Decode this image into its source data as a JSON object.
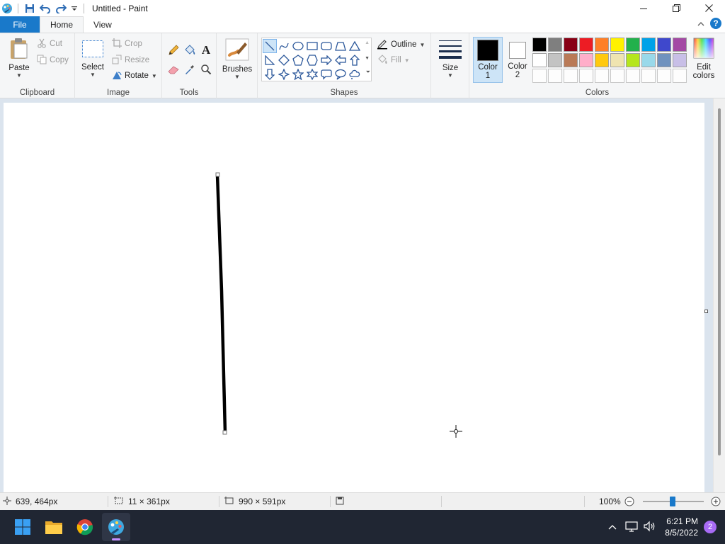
{
  "window": {
    "title": "Untitled - Paint"
  },
  "tabs": [
    {
      "label": "File"
    },
    {
      "label": "Home"
    },
    {
      "label": "View"
    }
  ],
  "clipboard": {
    "group_label": "Clipboard",
    "paste": "Paste",
    "cut": "Cut",
    "copy": "Copy"
  },
  "image": {
    "group_label": "Image",
    "select": "Select",
    "crop": "Crop",
    "resize": "Resize",
    "rotate": "Rotate"
  },
  "tools": {
    "group_label": "Tools"
  },
  "brushes": {
    "label": "Brushes"
  },
  "shapes": {
    "group_label": "Shapes",
    "outline": "Outline",
    "fill": "Fill",
    "icons": [
      "line-icon",
      "curve-icon",
      "oval-icon",
      "rectangle-icon",
      "rounded-rectangle-icon",
      "polygon-icon",
      "triangle-icon",
      "right-triangle-icon",
      "diamond-icon",
      "pentagon-icon",
      "hexagon-icon",
      "right-arrow-icon",
      "left-arrow-icon",
      "up-arrow-icon",
      "down-arrow-icon",
      "four-point-star-icon",
      "five-point-star-icon",
      "six-point-star-icon",
      "rounded-callout-icon",
      "oval-callout-icon",
      "cloud-callout-icon"
    ],
    "selected": "line-icon"
  },
  "size": {
    "label": "Size"
  },
  "colors": {
    "group_label": "Colors",
    "color1_line1": "Color",
    "color1_line2": "1",
    "color2_line1": "Color",
    "color2_line2": "2",
    "color1_value": "#000000",
    "color2_value": "#ffffff",
    "edit_line1": "Edit",
    "edit_line2": "colors",
    "palette_row1": [
      "#000000",
      "#7f7f7f",
      "#880015",
      "#ed1c24",
      "#ff7f27",
      "#fff200",
      "#22b14c",
      "#00a2e8",
      "#3f48cc",
      "#a349a4"
    ],
    "palette_row2": [
      "#ffffff",
      "#c3c3c3",
      "#b97a57",
      "#ffaec9",
      "#ffc90e",
      "#efe4b0",
      "#b5e61d",
      "#99d9ea",
      "#7092be",
      "#c8bfe7"
    ],
    "palette_row3_count": 10
  },
  "canvas": {
    "stroke_color": "#000000"
  },
  "status": {
    "cursor_pos": "639, 464px",
    "selection_size": "11 × 361px",
    "canvas_size": "990 × 591px",
    "zoom": "100%"
  },
  "taskbar": {
    "apps": [
      "windows-start-icon",
      "file-explorer-icon",
      "chrome-icon",
      "paint-icon"
    ],
    "time": "6:21 PM",
    "date": "8/5/2022",
    "notifications": "2"
  }
}
